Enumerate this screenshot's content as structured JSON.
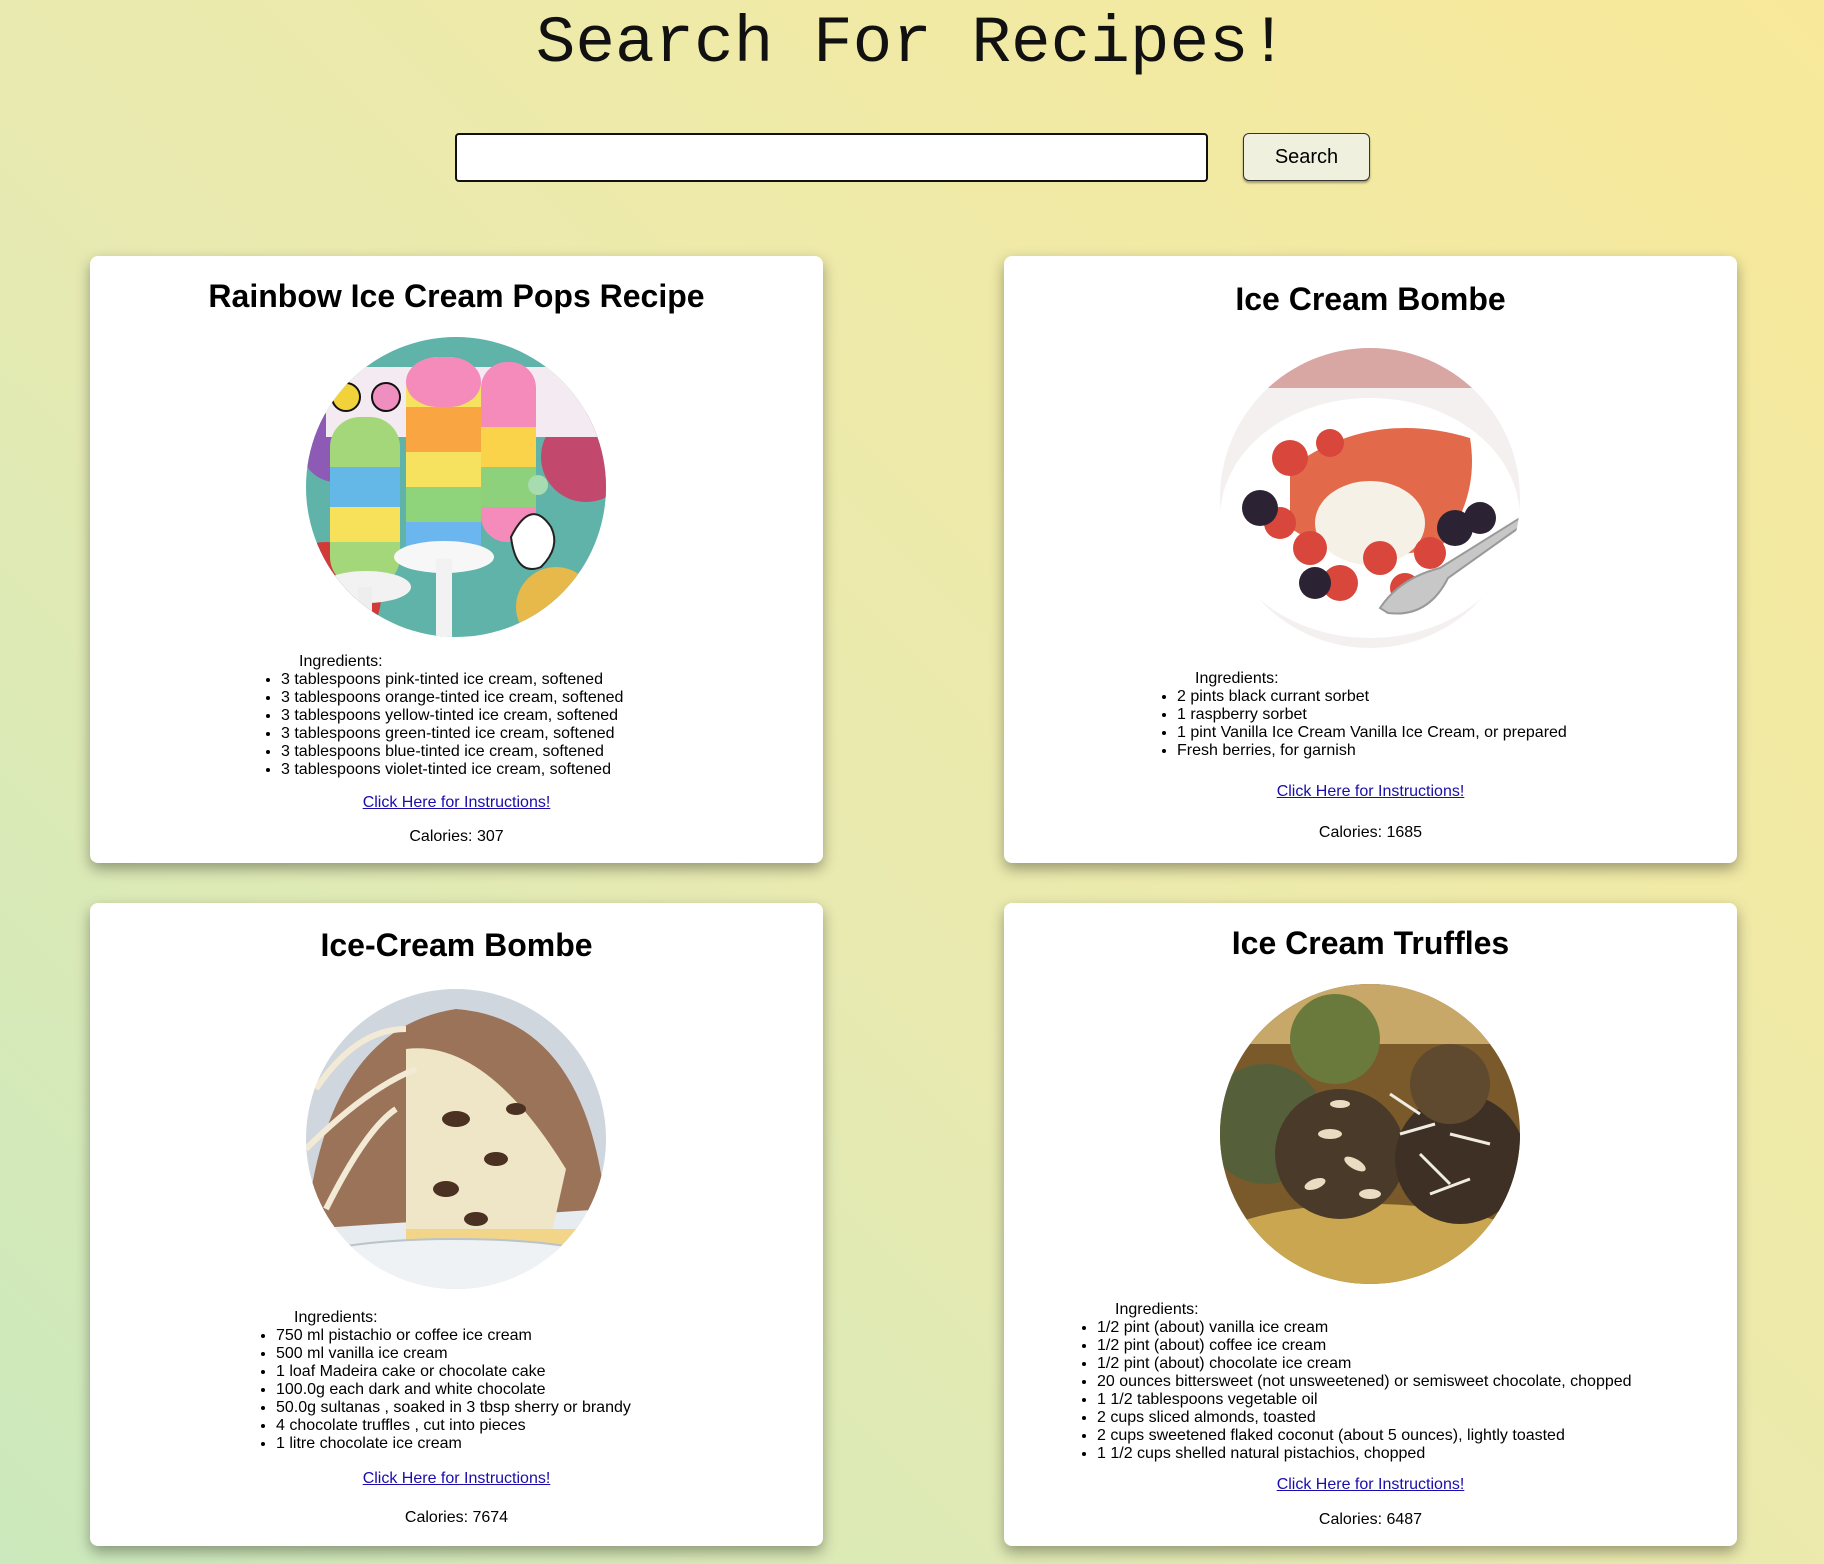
{
  "header": {
    "title": "Search For Recipes!",
    "search_value": "",
    "search_button_label": "Search"
  },
  "recipes": [
    {
      "title": "Rainbow Ice Cream Pops Recipe",
      "image_icon": "rainbow-ice-cream-pops-photo",
      "ingredients_label": "Ingredients:",
      "ingredients": [
        "3 tablespoons pink-tinted ice cream, softened",
        "3 tablespoons orange-tinted ice cream, softened",
        "3 tablespoons yellow-tinted ice cream, softened",
        "3 tablespoons green-tinted ice cream, softened",
        "3 tablespoons blue-tinted ice cream, softened",
        "3 tablespoons violet-tinted ice cream, softened"
      ],
      "link_label": "Click Here for Instructions!",
      "calories_text": "Calories: 307"
    },
    {
      "title": "Ice Cream Bombe",
      "image_icon": "ice-cream-bombe-with-berries-photo",
      "ingredients_label": "Ingredients:",
      "ingredients": [
        "2 pints black currant sorbet",
        "1 raspberry sorbet",
        "1 pint Vanilla Ice Cream Vanilla Ice Cream, or prepared",
        "Fresh berries, for garnish"
      ],
      "link_label": "Click Here for Instructions!",
      "calories_text": "Calories: 1685"
    },
    {
      "title": "Ice-Cream Bombe",
      "image_icon": "chocolate-ice-cream-bombe-photo",
      "ingredients_label": "Ingredients:",
      "ingredients": [
        "750 ml pistachio or coffee ice cream",
        "500 ml vanilla ice cream",
        "1 loaf Madeira cake or chocolate cake",
        "100.0g each dark and white chocolate",
        "50.0g sultanas , soaked in 3 tbsp sherry or brandy",
        "4 chocolate truffles , cut into pieces",
        "1 litre chocolate ice cream"
      ],
      "link_label": "Click Here for Instructions!",
      "calories_text": "Calories: 7674"
    },
    {
      "title": "Ice Cream Truffles",
      "image_icon": "ice-cream-truffles-photo",
      "ingredients_label": "Ingredients:",
      "ingredients": [
        "1/2 pint (about) vanilla ice cream",
        "1/2 pint (about) coffee ice cream",
        "1/2 pint (about) chocolate ice cream",
        "20 ounces bittersweet (not unsweetened) or semisweet chocolate, chopped",
        "1 1/2 tablespoons vegetable oil",
        "2 cups sliced almonds, toasted",
        "2 cups sweetened flaked coconut (about 5 ounces), lightly toasted",
        "1 1/2 cups shelled natural pistachios, chopped"
      ],
      "link_label": "Click Here for Instructions!",
      "calories_text": "Calories: 6487"
    }
  ]
}
